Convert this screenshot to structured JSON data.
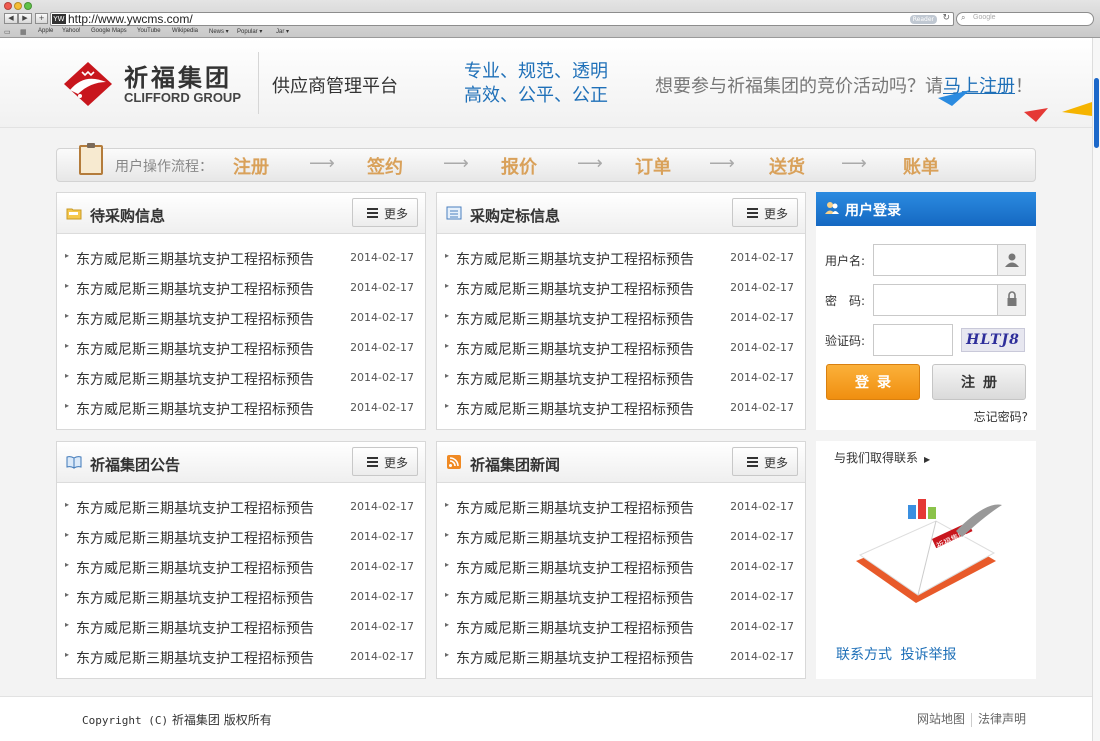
{
  "browser": {
    "url": "http://www.ywcms.com/",
    "favicon_text": "YW",
    "reader_label": "Reader",
    "search_placeholder": "Google",
    "bookmarks": [
      "Apple",
      "Yahoo!",
      "Google Maps",
      "YouTube",
      "Wikipedia",
      "News ▾",
      "Popular ▾",
      "Jar ▾"
    ]
  },
  "header": {
    "logo_cn": "祈福集团",
    "logo_en": "CLIFFORD GROUP",
    "platform_name": "供应商管理平台",
    "slogan_line1": "专业、规范、透明",
    "slogan_line2": "高效、公平、公正",
    "invite_text": "想要参与祈福集团的竞价活动吗？请",
    "invite_link": "马上注册",
    "invite_end": "！"
  },
  "process": {
    "label": "用户操作流程：",
    "steps": [
      "注册",
      "签约",
      "报价",
      "订单",
      "送货",
      "账单"
    ],
    "arrow": "⟶"
  },
  "panels": [
    {
      "title": "待采购信息",
      "more": "更多",
      "items": [
        {
          "title": "东方威尼斯三期基坑支护工程招标预告",
          "date": "2014-02-17"
        },
        {
          "title": "东方威尼斯三期基坑支护工程招标预告",
          "date": "2014-02-17"
        },
        {
          "title": "东方威尼斯三期基坑支护工程招标预告",
          "date": "2014-02-17"
        },
        {
          "title": "东方威尼斯三期基坑支护工程招标预告",
          "date": "2014-02-17"
        },
        {
          "title": "东方威尼斯三期基坑支护工程招标预告",
          "date": "2014-02-17"
        },
        {
          "title": "东方威尼斯三期基坑支护工程招标预告",
          "date": "2014-02-17"
        }
      ]
    },
    {
      "title": "采购定标信息",
      "more": "更多",
      "items": [
        {
          "title": "东方威尼斯三期基坑支护工程招标预告",
          "date": "2014-02-17"
        },
        {
          "title": "东方威尼斯三期基坑支护工程招标预告",
          "date": "2014-02-17"
        },
        {
          "title": "东方威尼斯三期基坑支护工程招标预告",
          "date": "2014-02-17"
        },
        {
          "title": "东方威尼斯三期基坑支护工程招标预告",
          "date": "2014-02-17"
        },
        {
          "title": "东方威尼斯三期基坑支护工程招标预告",
          "date": "2014-02-17"
        },
        {
          "title": "东方威尼斯三期基坑支护工程招标预告",
          "date": "2014-02-17"
        }
      ]
    },
    {
      "title": "祈福集团公告",
      "more": "更多",
      "items": [
        {
          "title": "东方威尼斯三期基坑支护工程招标预告",
          "date": "2014-02-17"
        },
        {
          "title": "东方威尼斯三期基坑支护工程招标预告",
          "date": "2014-02-17"
        },
        {
          "title": "东方威尼斯三期基坑支护工程招标预告",
          "date": "2014-02-17"
        },
        {
          "title": "东方威尼斯三期基坑支护工程招标预告",
          "date": "2014-02-17"
        },
        {
          "title": "东方威尼斯三期基坑支护工程招标预告",
          "date": "2014-02-17"
        },
        {
          "title": "东方威尼斯三期基坑支护工程招标预告",
          "date": "2014-02-17"
        }
      ]
    },
    {
      "title": "祈福集团新闻",
      "more": "更多",
      "items": [
        {
          "title": "东方威尼斯三期基坑支护工程招标预告",
          "date": "2014-02-17"
        },
        {
          "title": "东方威尼斯三期基坑支护工程招标预告",
          "date": "2014-02-17"
        },
        {
          "title": "东方威尼斯三期基坑支护工程招标预告",
          "date": "2014-02-17"
        },
        {
          "title": "东方威尼斯三期基坑支护工程招标预告",
          "date": "2014-02-17"
        },
        {
          "title": "东方威尼斯三期基坑支护工程招标预告",
          "date": "2014-02-17"
        },
        {
          "title": "东方威尼斯三期基坑支护工程招标预告",
          "date": "2014-02-17"
        }
      ]
    }
  ],
  "login": {
    "title": "用户登录",
    "username_label": "用户名:",
    "username_value": "",
    "password_label": "密　码:",
    "password_value": "",
    "captcha_label": "验证码:",
    "captcha_value": "",
    "captcha_text": "HLTJ8",
    "login_button": "登录",
    "register_button": "注册",
    "forgot_link": "忘记密码?"
  },
  "contact": {
    "title": "与我们取得联系",
    "book_label": "祈福集团",
    "link_contact": "联系方式",
    "link_complaint": "投诉举报"
  },
  "footer": {
    "copyright_prefix": "Copyright (C)",
    "copyright_company": "祈福集团 版权所有",
    "sitemap": "网站地图",
    "legal": "法律声明"
  },
  "colors": {
    "brand_blue": "#1f70b8",
    "brand_red": "#c8161d",
    "step_orange": "#d9a15a",
    "login_orange": "#f08f10",
    "login_header_blue": "#1568c2"
  }
}
